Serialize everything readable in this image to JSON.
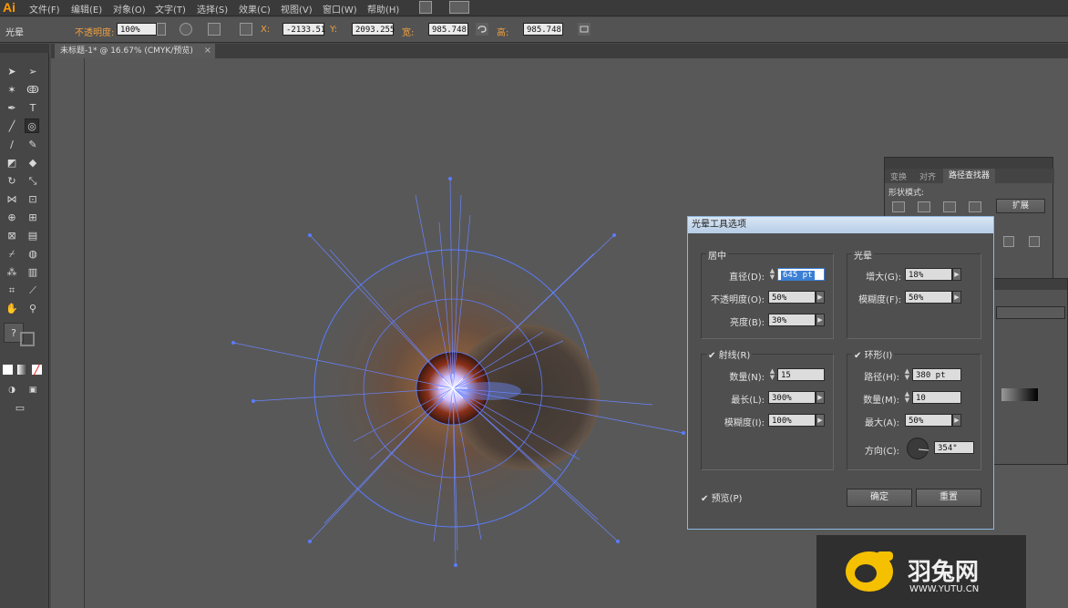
{
  "app": {
    "logo": "Ai"
  },
  "menu": [
    "文件(F)",
    "编辑(E)",
    "对象(O)",
    "文字(T)",
    "选择(S)",
    "效果(C)",
    "视图(V)",
    "窗口(W)",
    "帮助(H)"
  ],
  "control": {
    "tool_name": "光晕",
    "opacity_label": "不透明度:",
    "opacity_value": "100%",
    "x_label": "X:",
    "x_value": "-2133.51",
    "y_label": "Y:",
    "y_value": "2093.255",
    "w_label": "宽:",
    "w_value": "985.748",
    "h_label": "高:",
    "h_value": "985.748"
  },
  "document": {
    "tab_title": "未标题-1* @ 16.67% (CMYK/预览)",
    "close": "×"
  },
  "pathfinder_panel": {
    "tabs": [
      "变换",
      "对齐",
      "路径查找器"
    ],
    "shape_modes_label": "形状模式:",
    "expand_label": "扩展"
  },
  "dialog": {
    "title": "光晕工具选项",
    "center": {
      "label": "居中",
      "diameter_label": "直径(D):",
      "diameter_value": "645 pt",
      "opacity_label": "不透明度(O):",
      "opacity_value": "50%",
      "brightness_label": "亮度(B):",
      "brightness_value": "30%"
    },
    "halo": {
      "label": "光晕",
      "growth_label": "增大(G):",
      "growth_value": "18%",
      "fuzziness_label": "模糊度(F):",
      "fuzziness_value": "50%"
    },
    "rays": {
      "label": "射线(R)",
      "checked": true,
      "number_label": "数量(N):",
      "number_value": "15",
      "longest_label": "最长(L):",
      "longest_value": "300%",
      "fuzziness_label": "模糊度(I):",
      "fuzziness_value": "100%"
    },
    "rings": {
      "label": "环形(I)",
      "checked": true,
      "path_label": "路径(H):",
      "path_value": "380 pt",
      "number_label": "数量(M):",
      "number_value": "10",
      "largest_label": "最大(A):",
      "largest_value": "50%",
      "direction_label": "方向(C):",
      "direction_value": "354°"
    },
    "preview_label": "预览(P)",
    "ok_label": "确定",
    "reset_label": "重置"
  },
  "watermark": {
    "brand": "羽兔网",
    "url": "WWW.YUTU.CN"
  },
  "colors": {
    "accent": "#ff9a00",
    "flare_blue": "#5a7cff",
    "dialog_title": "#c5d8ec"
  }
}
